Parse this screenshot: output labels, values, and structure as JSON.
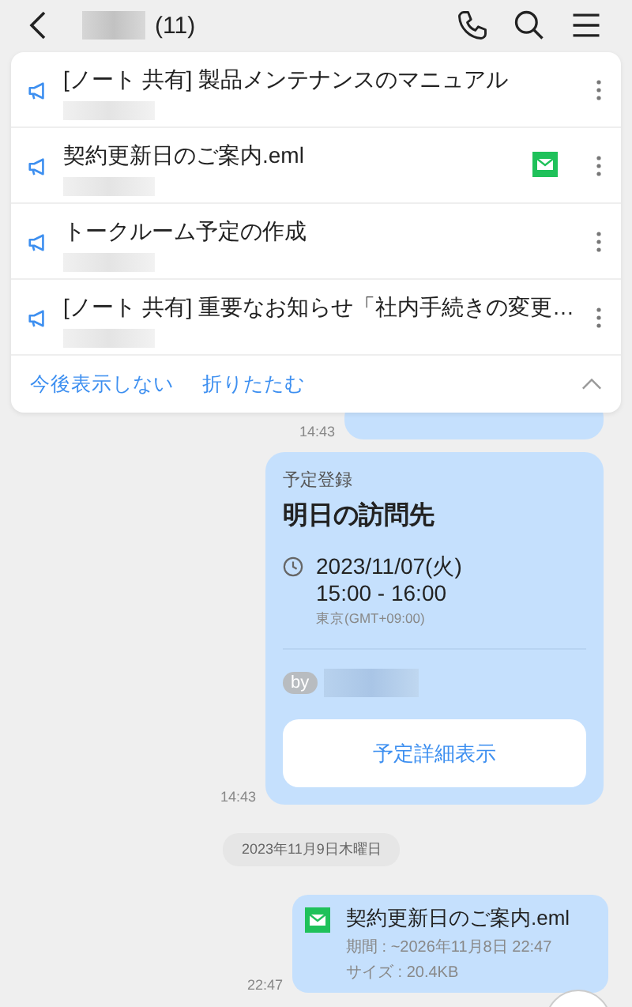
{
  "header": {
    "count": "(11)"
  },
  "announcements": {
    "expanded": true,
    "items": [
      {
        "title": "[ノート 共有] 製品メンテナンスのマニュアル",
        "mail": false
      },
      {
        "title": "契約更新日のご案内.eml",
        "mail": true
      },
      {
        "title": "トークルーム予定の作成",
        "mail": false
      },
      {
        "title": "[ノート 共有] 重要なお知らせ「社内手続きの変更…",
        "mail": false
      }
    ],
    "actions": [
      "今後表示しない",
      "折りたたむ"
    ]
  },
  "messages": [
    {
      "kind": "hidden",
      "time": "14:43"
    },
    {
      "kind": "event",
      "time": "14:43",
      "label": "予定登録",
      "title": "明日の訪問先",
      "date": "2023/11/07(火)",
      "hours": "15:00 - 16:00",
      "zone": "東京(GMT+09:00)",
      "by": "by",
      "button": "予定詳細表示"
    },
    {
      "kind": "date",
      "text": "2023年11月9日木曜日"
    },
    {
      "kind": "file",
      "time": "22:47",
      "name": "契約更新日のご案内.eml",
      "period": "期間 : ~2026年11月8日 22:47",
      "size": "サイズ : 20.4KB"
    }
  ]
}
